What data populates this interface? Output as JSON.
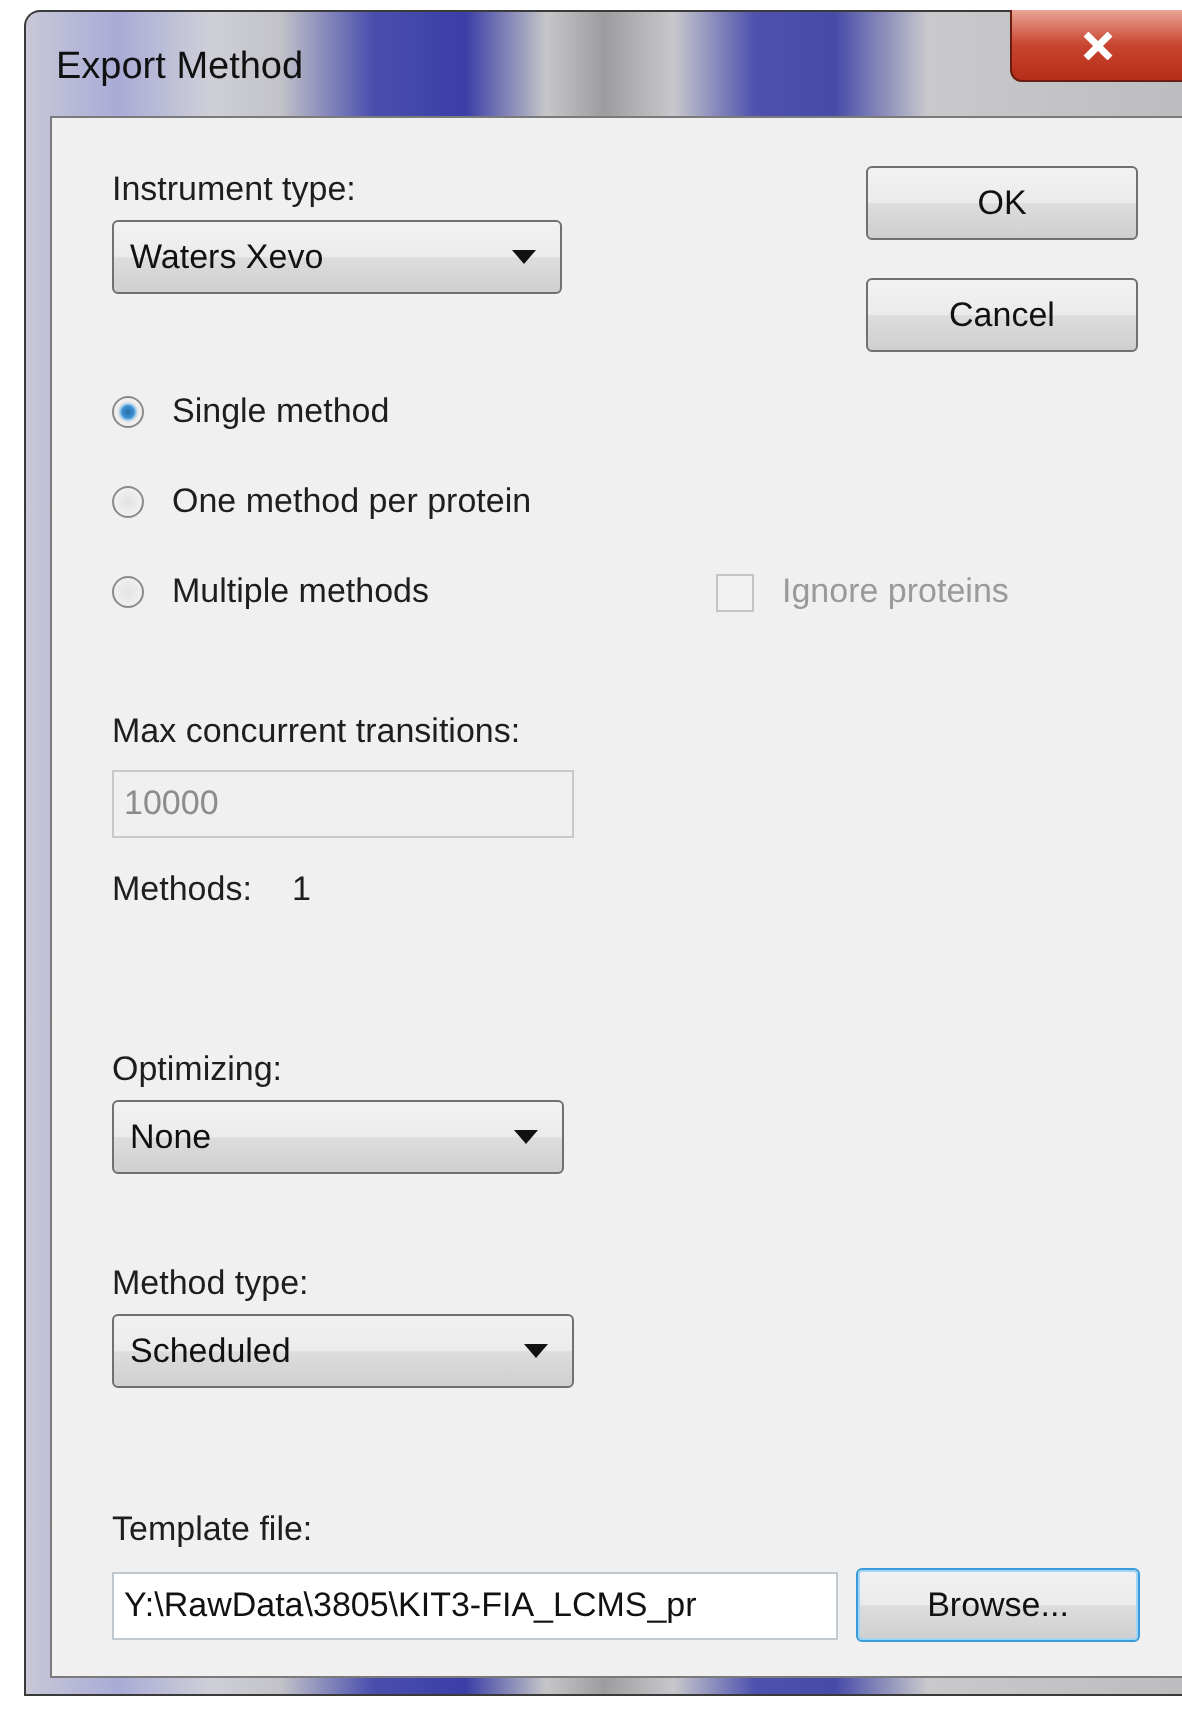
{
  "window": {
    "title": "Export Method"
  },
  "instrument_type": {
    "label": "Instrument type:",
    "value": "Waters Xevo"
  },
  "buttons": [
    {
      "label": "OK",
      "default": false
    },
    {
      "label": "Cancel",
      "default": false
    }
  ],
  "radios": [
    {
      "label": "Single method",
      "selected": true
    },
    {
      "label": "One method per protein",
      "selected": false
    },
    {
      "label": "Multiple methods",
      "selected": false
    }
  ],
  "ignore_proteins": {
    "label": "Ignore proteins",
    "checked": false,
    "disabled": true
  },
  "max_concurrent_transitions": {
    "label": "Max concurrent transitions:",
    "value": "10000",
    "disabled": true
  },
  "methods": {
    "label": "Methods:",
    "value": "1"
  },
  "optimizing": {
    "label": "Optimizing:",
    "value": "None"
  },
  "method_type": {
    "label": "Method type:",
    "value": "Scheduled"
  },
  "template_file": {
    "label": "Template file:",
    "value": "Y:\\RawData\\3805\\KIT3-FIA_LCMS_pr",
    "browse": {
      "label": "Browse...",
      "default": true
    }
  }
}
